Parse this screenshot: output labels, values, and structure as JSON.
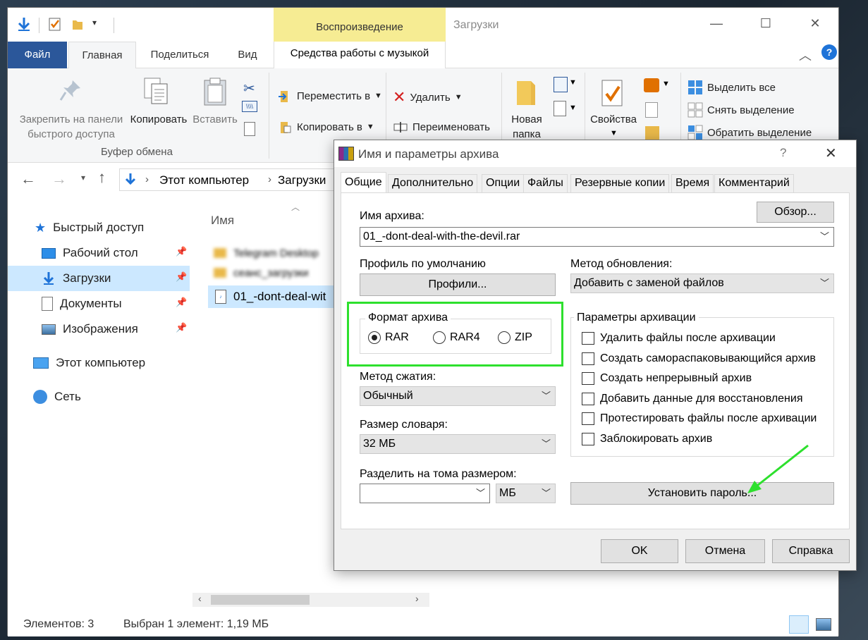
{
  "explorer": {
    "window_title": "Загрузки",
    "context_tab": "Воспроизведение",
    "context_subtab": "Средства работы с музыкой",
    "tabs": [
      "Файл",
      "Главная",
      "Поделиться",
      "Вид"
    ],
    "ribbon": {
      "pin_label": "Закрепить на панели быстрого доступа",
      "pin_line1": "Закрепить на панели",
      "pin_line2": "быстрого доступа",
      "copy_label": "Копировать",
      "paste_label": "Вставить",
      "clipboard_group": "Буфер обмена",
      "move_to": "Переместить в",
      "copy_to": "Копировать в",
      "delete": "Удалить",
      "rename": "Переименовать",
      "new_folder_line1": "Новая",
      "new_folder_line2": "папка",
      "properties": "Свойства",
      "select_all": "Выделить все",
      "select_none": "Снять выделение",
      "invert_selection": "Обратить выделение"
    },
    "address": {
      "crumb1": "Этот компьютер",
      "crumb2": "Загрузки"
    },
    "nav": {
      "quick_access": "Быстрый доступ",
      "desktop": "Рабочий стол",
      "downloads": "Загрузки",
      "documents": "Документы",
      "pictures": "Изображения",
      "this_pc": "Этот компьютер",
      "network": "Сеть"
    },
    "files": {
      "column_name": "Имя",
      "file1": "Telegram Desktop",
      "file2": "сеанс_загрузки",
      "file3": "01_-dont-deal-wit"
    },
    "status": {
      "items": "Элементов: 3",
      "selected": "Выбран 1 элемент: 1,19 МБ"
    }
  },
  "dialog": {
    "title": "Имя и параметры архива",
    "help": "?",
    "tabs": [
      "Общие",
      "Дополнительно",
      "Опции",
      "Файлы",
      "Резервные копии",
      "Время",
      "Комментарий"
    ],
    "archive_name_label": "Имя архива:",
    "browse": "Обзор...",
    "archive_name": "01_-dont-deal-with-the-devil.rar",
    "profile_label": "Профиль по умолчанию",
    "profiles_button": "Профили...",
    "update_method_label": "Метод обновления:",
    "update_method": "Добавить с заменой файлов",
    "format_label": "Формат архива",
    "formats": [
      "RAR",
      "RAR4",
      "ZIP"
    ],
    "selected_format": "RAR",
    "compression_label": "Метод сжатия:",
    "compression": "Обычный",
    "dict_label": "Размер словаря:",
    "dict": "32 МБ",
    "split_label": "Разделить на тома размером:",
    "split_value": "",
    "split_unit": "МБ",
    "options_label": "Параметры архивации",
    "options": [
      "Удалить файлы после архивации",
      "Создать самораспаковывающийся архив",
      "Создать непрерывный архив",
      "Добавить данные для восстановления",
      "Протестировать файлы после архивации",
      "Заблокировать архив"
    ],
    "set_password": "Установить пароль...",
    "ok": "OK",
    "cancel": "Отмена",
    "help_button": "Справка"
  },
  "colors": {
    "file_tab": "#2b579a",
    "context_tab": "#f6ec93",
    "highlight_box": "#2de02d",
    "arrow": "#2de02d",
    "selection": "#cce8ff"
  }
}
